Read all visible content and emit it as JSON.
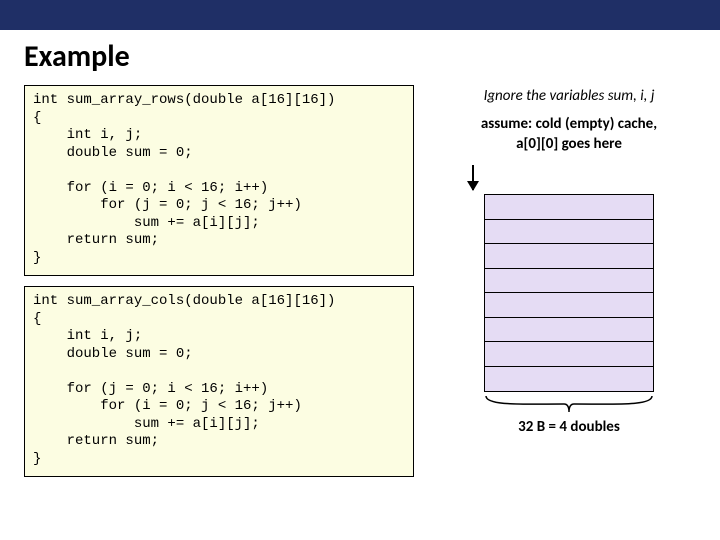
{
  "title": "Example",
  "code1": "int sum_array_rows(double a[16][16])\n{\n    int i, j;\n    double sum = 0;\n\n    for (i = 0; i < 16; i++)\n        for (j = 0; j < 16; j++)\n            sum += a[i][j];\n    return sum;\n}",
  "code2": "int sum_array_cols(double a[16][16])\n{\n    int i, j;\n    double sum = 0;\n\n    for (j = 0; i < 16; i++)\n        for (i = 0; j < 16; j++)\n            sum += a[i][j];\n    return sum;\n}",
  "note1": "Ignore the variables sum, i, j",
  "note2a": "assume: cold (empty) cache,",
  "note2b": "a[0][0] goes here",
  "cache_slots": 8,
  "brace_label": "32 B = 4 doubles"
}
